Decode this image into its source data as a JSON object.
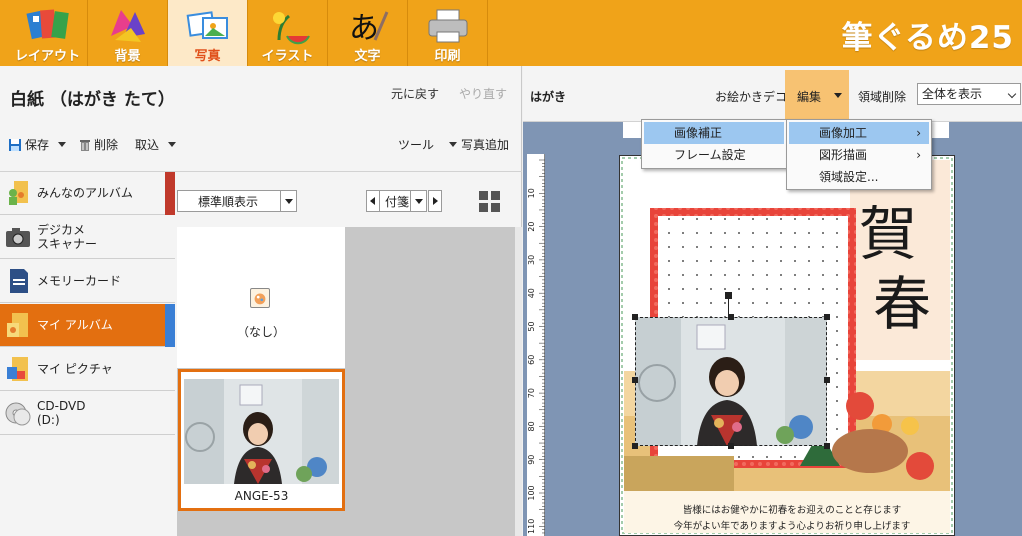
{
  "ribbon": {
    "tabs": [
      {
        "label": "レイアウト",
        "icon": "layout-icon"
      },
      {
        "label": "背景",
        "icon": "background-icon"
      },
      {
        "label": "写真",
        "icon": "photo-icon"
      },
      {
        "label": "イラスト",
        "icon": "illustration-icon"
      },
      {
        "label": "文字",
        "icon": "text-icon"
      },
      {
        "label": "印刷",
        "icon": "printer-icon"
      }
    ],
    "active_tab": "写真",
    "brand": "筆ぐるめ25"
  },
  "left": {
    "title": "白紙 （はがき たて）",
    "undo": "元に戻す",
    "redo": "やり直す",
    "toolbar": {
      "save": "保存",
      "delete": "削除",
      "import": "取込",
      "tools": "ツール",
      "add_photo": "写真追加"
    },
    "sources": [
      {
        "label": "みんなのアルバム",
        "icon": "people-album-icon"
      },
      {
        "label": "デジカメ\nスキャナー",
        "icon": "camera-icon"
      },
      {
        "label": "メモリーカード",
        "icon": "memory-card-icon"
      },
      {
        "label": "マイ アルバム",
        "icon": "my-album-icon"
      },
      {
        "label": "マイ ピクチャ",
        "icon": "my-pictures-icon"
      },
      {
        "label": "CD-DVD\n(D:)",
        "icon": "cd-dvd-icon"
      }
    ],
    "active_source": "マイ アルバム",
    "sort_select": "標準順表示",
    "tag_select": "付箋",
    "thumbnails": [
      {
        "label": "（なし）"
      },
      {
        "label": "ANGE-53"
      }
    ]
  },
  "right": {
    "paper_type": "はがき",
    "picture_deco": "お絵かきデコ",
    "edit": "編集",
    "area_delete": "領域削除",
    "view_select": "全体を表示",
    "menu_edit": [
      "画像補正",
      "フレーム設定"
    ],
    "menu_sub": [
      "画像加工",
      "図形描画",
      "領域設定..."
    ],
    "card_title_glyphs": [
      "賀",
      "春"
    ],
    "greeting_lines": [
      "皆様にはお健やかに初春をお迎えのことと存じます",
      "今年がよい年でありますよう心よりお祈り申し上げます"
    ],
    "ruler_marks": [
      "10",
      "20",
      "30",
      "40",
      "50",
      "60",
      "70",
      "80",
      "90",
      "100",
      "110"
    ]
  },
  "colors": {
    "ribbon": "#f0a319",
    "active_source": "#e36f10",
    "canvas_bg": "#7f95b4",
    "menu_highlight": "#9cc7f0"
  }
}
